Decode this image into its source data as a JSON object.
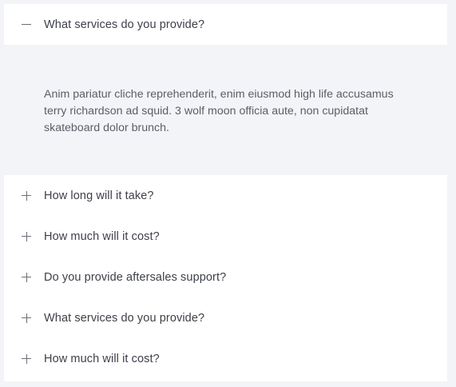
{
  "faq": {
    "open_item": {
      "question": "What services do you provide?",
      "icon": "minus-icon",
      "answer": "Anim pariatur cliche reprehenderit, enim eiusmod high life accusamus terry richardson ad squid. 3 wolf moon officia aute, non cupidatat skateboard dolor brunch."
    },
    "collapsed_items": [
      {
        "question": "How long will it take?",
        "icon": "plus-icon"
      },
      {
        "question": "How much will it cost?",
        "icon": "plus-icon"
      },
      {
        "question": "Do you provide aftersales support?",
        "icon": "plus-icon"
      },
      {
        "question": "What services do you provide?",
        "icon": "plus-icon"
      },
      {
        "question": "How much will it cost?",
        "icon": "plus-icon"
      }
    ]
  }
}
